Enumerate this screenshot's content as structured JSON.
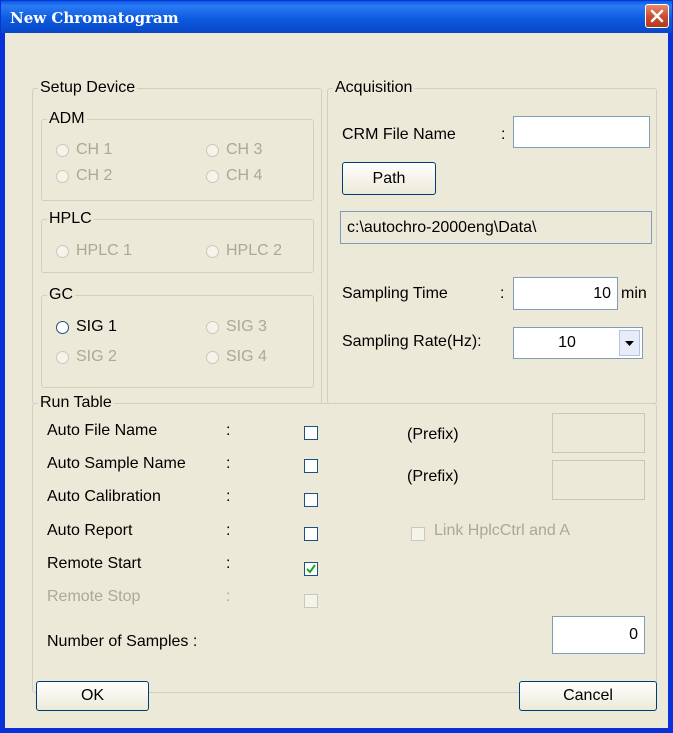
{
  "window": {
    "title": "New Chromatogram"
  },
  "setup_device": {
    "label": "Setup Device",
    "adm": {
      "label": "ADM",
      "channels": [
        "CH 1",
        "CH 3",
        "CH 2",
        "CH 4"
      ]
    },
    "hplc": {
      "label": "HPLC",
      "options": [
        "HPLC 1",
        "HPLC 2"
      ]
    },
    "gc": {
      "label": "GC",
      "signals": [
        "SIG 1",
        "SIG 3",
        "SIG 2",
        "SIG 4"
      ]
    }
  },
  "acquisition": {
    "label": "Acquisition",
    "crm_file_label": "CRM File Name",
    "colon": ":",
    "crm_file_value": "",
    "path_button": "Path",
    "path_value": "c:\\autochro-2000eng\\Data\\",
    "sampling_time_label": "Sampling Time",
    "sampling_time_value": "10",
    "sampling_time_unit": "min",
    "sampling_rate_label": "Sampling Rate(Hz):",
    "sampling_rate_value": "10"
  },
  "run_table": {
    "label": "Run Table",
    "rows": [
      {
        "label": "Auto File Name",
        "colon": ":",
        "checked": false,
        "enabled": true
      },
      {
        "label": "Auto Sample Name",
        "colon": ":",
        "checked": false,
        "enabled": true
      },
      {
        "label": "Auto Calibration",
        "colon": ":",
        "checked": false,
        "enabled": true
      },
      {
        "label": "Auto Report",
        "colon": ":",
        "checked": false,
        "enabled": true
      },
      {
        "label": "Remote Start",
        "colon": ":",
        "checked": true,
        "enabled": true
      },
      {
        "label": "Remote Stop",
        "colon": ":",
        "checked": false,
        "enabled": false
      }
    ],
    "prefix_label": "(Prefix)",
    "prefix_file_value": "",
    "prefix_sample_value": "",
    "link_label": "Link HplcCtrl and A",
    "number_of_samples_label": "Number of Samples :",
    "number_of_samples_value": "0"
  },
  "buttons": {
    "ok": "OK",
    "cancel": "Cancel"
  }
}
